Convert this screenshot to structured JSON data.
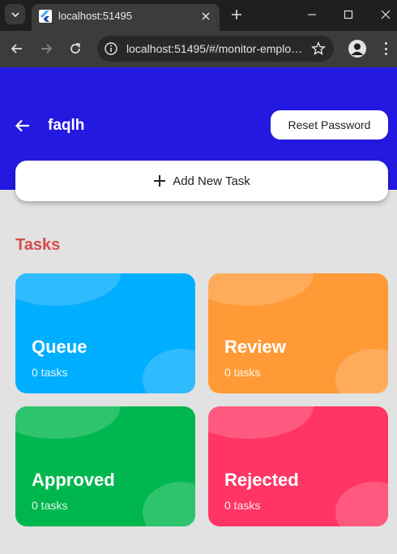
{
  "browser": {
    "tab_title": "localhost:51495",
    "url": "localhost:51495/#/monitor-emplo…",
    "chrome_bg": "#1f1f1f"
  },
  "app": {
    "title": "faqlh",
    "reset_label": "Reset Password",
    "add_task_label": "Add New Task",
    "section_title": "Tasks",
    "accent": "#2319e0"
  },
  "cards": [
    {
      "title": "Queue",
      "count": "0 tasks",
      "color": "#00aeff"
    },
    {
      "title": "Review",
      "count": "0 tasks",
      "color": "#ff9a36"
    },
    {
      "title": "Approved",
      "count": "0 tasks",
      "color": "#00b64e"
    },
    {
      "title": "Rejected",
      "count": "0 tasks",
      "color": "#ff3565"
    }
  ]
}
